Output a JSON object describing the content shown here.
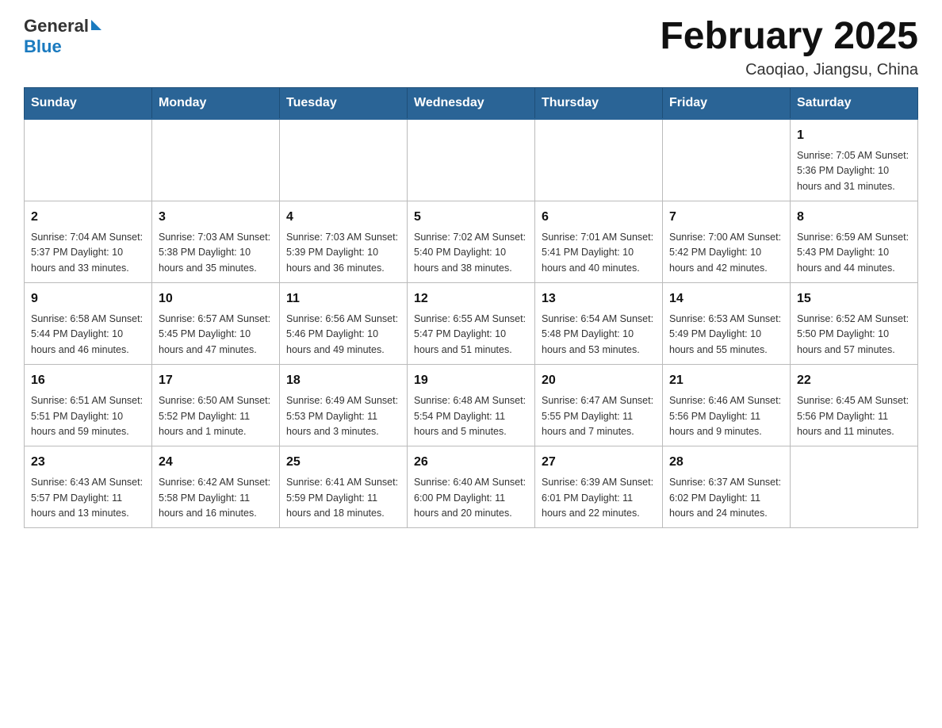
{
  "header": {
    "logo_general": "General",
    "logo_blue": "Blue",
    "title": "February 2025",
    "subtitle": "Caoqiao, Jiangsu, China"
  },
  "days_of_week": [
    "Sunday",
    "Monday",
    "Tuesday",
    "Wednesday",
    "Thursday",
    "Friday",
    "Saturday"
  ],
  "weeks": [
    [
      {
        "day": "",
        "info": ""
      },
      {
        "day": "",
        "info": ""
      },
      {
        "day": "",
        "info": ""
      },
      {
        "day": "",
        "info": ""
      },
      {
        "day": "",
        "info": ""
      },
      {
        "day": "",
        "info": ""
      },
      {
        "day": "1",
        "info": "Sunrise: 7:05 AM\nSunset: 5:36 PM\nDaylight: 10 hours and 31 minutes."
      }
    ],
    [
      {
        "day": "2",
        "info": "Sunrise: 7:04 AM\nSunset: 5:37 PM\nDaylight: 10 hours and 33 minutes."
      },
      {
        "day": "3",
        "info": "Sunrise: 7:03 AM\nSunset: 5:38 PM\nDaylight: 10 hours and 35 minutes."
      },
      {
        "day": "4",
        "info": "Sunrise: 7:03 AM\nSunset: 5:39 PM\nDaylight: 10 hours and 36 minutes."
      },
      {
        "day": "5",
        "info": "Sunrise: 7:02 AM\nSunset: 5:40 PM\nDaylight: 10 hours and 38 minutes."
      },
      {
        "day": "6",
        "info": "Sunrise: 7:01 AM\nSunset: 5:41 PM\nDaylight: 10 hours and 40 minutes."
      },
      {
        "day": "7",
        "info": "Sunrise: 7:00 AM\nSunset: 5:42 PM\nDaylight: 10 hours and 42 minutes."
      },
      {
        "day": "8",
        "info": "Sunrise: 6:59 AM\nSunset: 5:43 PM\nDaylight: 10 hours and 44 minutes."
      }
    ],
    [
      {
        "day": "9",
        "info": "Sunrise: 6:58 AM\nSunset: 5:44 PM\nDaylight: 10 hours and 46 minutes."
      },
      {
        "day": "10",
        "info": "Sunrise: 6:57 AM\nSunset: 5:45 PM\nDaylight: 10 hours and 47 minutes."
      },
      {
        "day": "11",
        "info": "Sunrise: 6:56 AM\nSunset: 5:46 PM\nDaylight: 10 hours and 49 minutes."
      },
      {
        "day": "12",
        "info": "Sunrise: 6:55 AM\nSunset: 5:47 PM\nDaylight: 10 hours and 51 minutes."
      },
      {
        "day": "13",
        "info": "Sunrise: 6:54 AM\nSunset: 5:48 PM\nDaylight: 10 hours and 53 minutes."
      },
      {
        "day": "14",
        "info": "Sunrise: 6:53 AM\nSunset: 5:49 PM\nDaylight: 10 hours and 55 minutes."
      },
      {
        "day": "15",
        "info": "Sunrise: 6:52 AM\nSunset: 5:50 PM\nDaylight: 10 hours and 57 minutes."
      }
    ],
    [
      {
        "day": "16",
        "info": "Sunrise: 6:51 AM\nSunset: 5:51 PM\nDaylight: 10 hours and 59 minutes."
      },
      {
        "day": "17",
        "info": "Sunrise: 6:50 AM\nSunset: 5:52 PM\nDaylight: 11 hours and 1 minute."
      },
      {
        "day": "18",
        "info": "Sunrise: 6:49 AM\nSunset: 5:53 PM\nDaylight: 11 hours and 3 minutes."
      },
      {
        "day": "19",
        "info": "Sunrise: 6:48 AM\nSunset: 5:54 PM\nDaylight: 11 hours and 5 minutes."
      },
      {
        "day": "20",
        "info": "Sunrise: 6:47 AM\nSunset: 5:55 PM\nDaylight: 11 hours and 7 minutes."
      },
      {
        "day": "21",
        "info": "Sunrise: 6:46 AM\nSunset: 5:56 PM\nDaylight: 11 hours and 9 minutes."
      },
      {
        "day": "22",
        "info": "Sunrise: 6:45 AM\nSunset: 5:56 PM\nDaylight: 11 hours and 11 minutes."
      }
    ],
    [
      {
        "day": "23",
        "info": "Sunrise: 6:43 AM\nSunset: 5:57 PM\nDaylight: 11 hours and 13 minutes."
      },
      {
        "day": "24",
        "info": "Sunrise: 6:42 AM\nSunset: 5:58 PM\nDaylight: 11 hours and 16 minutes."
      },
      {
        "day": "25",
        "info": "Sunrise: 6:41 AM\nSunset: 5:59 PM\nDaylight: 11 hours and 18 minutes."
      },
      {
        "day": "26",
        "info": "Sunrise: 6:40 AM\nSunset: 6:00 PM\nDaylight: 11 hours and 20 minutes."
      },
      {
        "day": "27",
        "info": "Sunrise: 6:39 AM\nSunset: 6:01 PM\nDaylight: 11 hours and 22 minutes."
      },
      {
        "day": "28",
        "info": "Sunrise: 6:37 AM\nSunset: 6:02 PM\nDaylight: 11 hours and 24 minutes."
      },
      {
        "day": "",
        "info": ""
      }
    ]
  ]
}
